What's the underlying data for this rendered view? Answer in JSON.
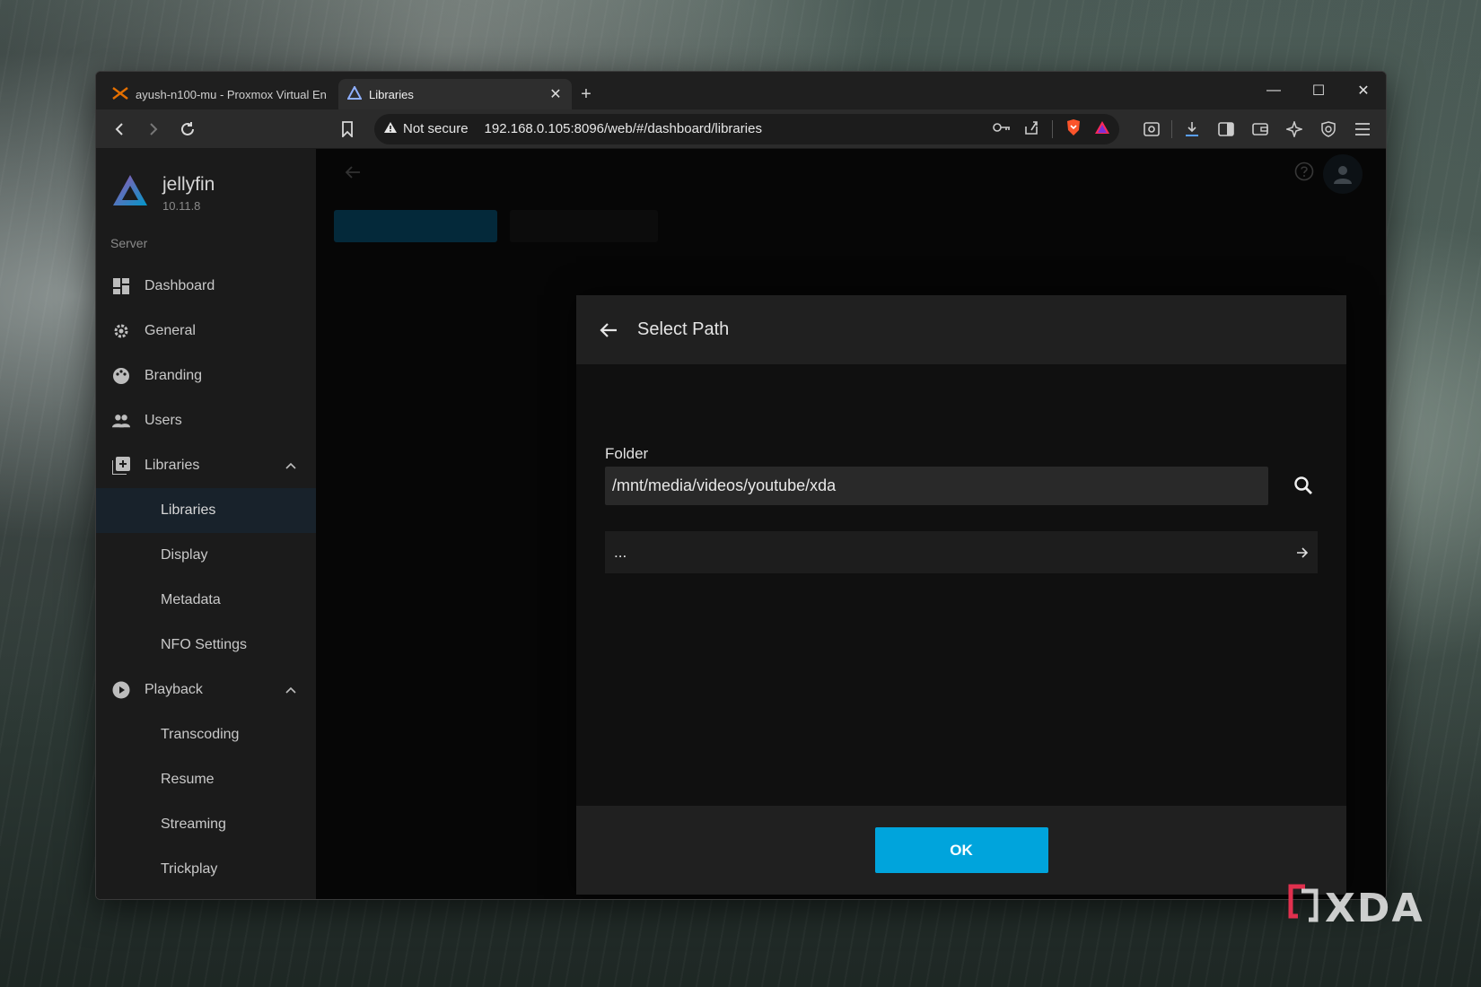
{
  "browser": {
    "tabs": [
      {
        "title": "ayush-n100-mu - Proxmox Virtual En",
        "active": false
      },
      {
        "title": "Libraries",
        "active": true
      }
    ],
    "new_tab": "+",
    "security_label": "Not secure",
    "url": "192.168.0.105:8096/web/#/dashboard/libraries"
  },
  "jellyfin": {
    "app_name": "jellyfin",
    "version": "10.11.8",
    "section_label": "Server",
    "nav": {
      "dashboard": "Dashboard",
      "general": "General",
      "branding": "Branding",
      "users": "Users",
      "libraries": "Libraries",
      "libraries_sub": [
        "Libraries",
        "Display",
        "Metadata",
        "NFO Settings"
      ],
      "playback": "Playback",
      "playback_sub": [
        "Transcoding",
        "Resume",
        "Streaming",
        "Trickplay"
      ]
    }
  },
  "dialog": {
    "title": "Select Path",
    "folder_label": "Folder",
    "folder_value": "/mnt/media/videos/youtube/xda",
    "dir_entry": "...",
    "ok_label": "OK"
  },
  "watermark": {
    "text": "XDA"
  },
  "colors": {
    "accent": "#00a4dc",
    "active_nav": "#18222b"
  }
}
